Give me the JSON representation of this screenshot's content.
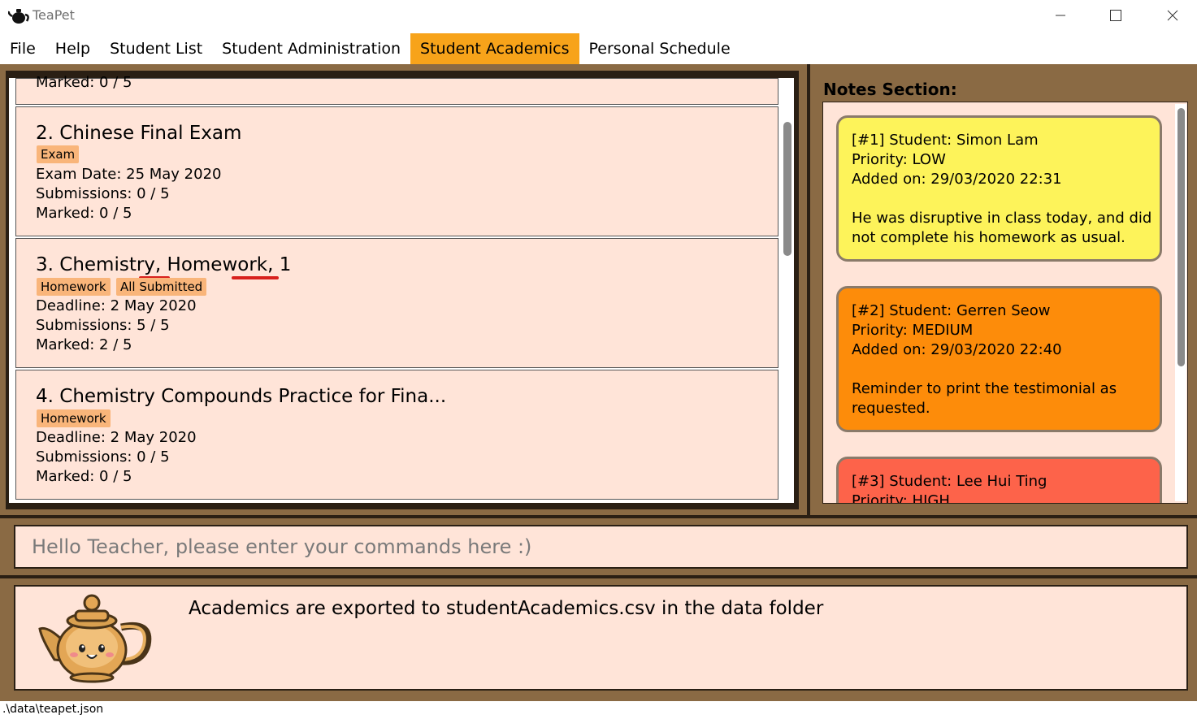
{
  "window": {
    "title": "TeaPet",
    "icon": "teapot-icon"
  },
  "menu": [
    {
      "label": "File",
      "active": false
    },
    {
      "label": "Help",
      "active": false
    },
    {
      "label": "Student List",
      "active": false
    },
    {
      "label": "Student Administration",
      "active": false
    },
    {
      "label": "Student Academics",
      "active": true
    },
    {
      "label": "Personal Schedule",
      "active": false
    }
  ],
  "academics": {
    "partial_top_line": "Marked: 0 / 5",
    "items": [
      {
        "title": "2.  Chinese Final Exam",
        "tags": [
          "Exam"
        ],
        "lines": [
          "Exam Date: 25 May 2020",
          "Submissions: 0 / 5",
          "Marked: 0 / 5"
        ]
      },
      {
        "title": "3.  Chemistry, Homework, 1",
        "tags": [
          "Homework",
          "All Submitted"
        ],
        "lines": [
          "Deadline: 2 May 2020",
          "Submissions: 5 / 5",
          "Marked: 2 / 5"
        ]
      },
      {
        "title": "4.  Chemistry Compounds Practice for Fina...",
        "tags": [
          "Homework"
        ],
        "lines": [
          "Deadline: 2 May 2020",
          "Submissions: 0 / 5",
          "Marked: 0 / 5"
        ]
      }
    ]
  },
  "notes": {
    "header": "Notes Section:",
    "items": [
      {
        "lines": [
          "[#1] Student: Simon Lam",
          "Priority: LOW",
          "Added on: 29/03/2020 22:31"
        ],
        "body": [
          "He was disruptive in class today, and did",
          "not complete his homework as usual."
        ],
        "color": "#fdf35a"
      },
      {
        "lines": [
          "[#2] Student: Gerren Seow",
          "Priority: MEDIUM",
          "Added on: 29/03/2020 22:40"
        ],
        "body": [
          "Reminder to print the testimonial as",
          "requested."
        ],
        "color": "#fd8c0a"
      },
      {
        "lines": [
          "[#3] Student: Lee Hui Ting",
          "Priority: HIGH"
        ],
        "body": [],
        "color": "#fd634a"
      }
    ]
  },
  "command": {
    "placeholder": "Hello Teacher, please enter your commands here :)"
  },
  "result": {
    "message": "Academics are exported to studentAcademics.csv in the data folder",
    "mascot": "teapot-mascot-icon"
  },
  "status": {
    "path": ".\\data\\teapet.json"
  },
  "colors": {
    "brown_bg": "#8a6a44",
    "dark_border": "#2a1f14",
    "panel_bg": "#ffe4d8",
    "active_tab": "#f7a31a",
    "tag_bg": "#f9b57a"
  }
}
